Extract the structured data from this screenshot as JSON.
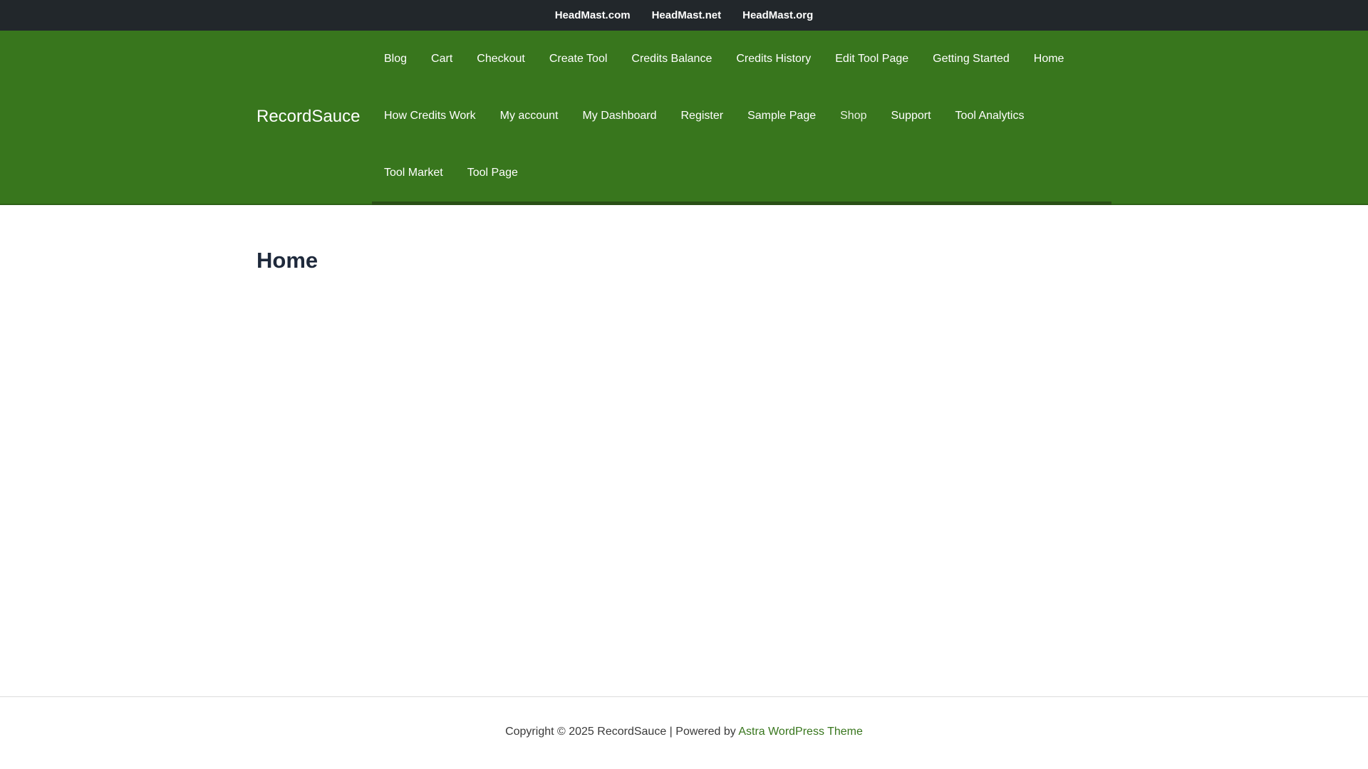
{
  "topbar": {
    "links": [
      "HeadMast.com",
      "HeadMast.net",
      "HeadMast.org"
    ]
  },
  "header": {
    "site_title": "RecordSauce",
    "nav_rows": [
      [
        "Blog",
        "Cart",
        "Checkout",
        "Create Tool",
        "Credits Balance",
        "Credits History",
        "Edit Tool Page",
        "Getting Started",
        "Home"
      ],
      [
        "How Credits Work",
        "My account",
        "My Dashboard",
        "Register",
        "Sample Page",
        "Shop",
        "Support",
        "Tool Analytics"
      ],
      [
        "Tool Market",
        "Tool Page"
      ]
    ]
  },
  "main": {
    "page_title": "Home"
  },
  "footer": {
    "copyright_prefix": "Copyright © 2025 RecordSauce | Powered by ",
    "theme_link": "Astra WordPress Theme"
  },
  "colors": {
    "topbar_bg": "#22272b",
    "header_bg": "#38761d",
    "title_color": "#1e293b",
    "link_accent": "#38761d"
  }
}
